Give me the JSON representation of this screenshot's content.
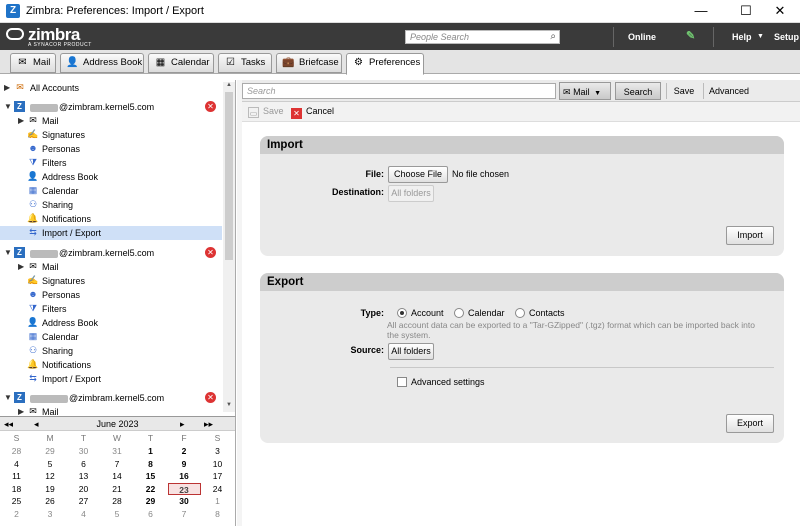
{
  "window": {
    "title": "Zimbra: Preferences: Import / Export",
    "app_icon": "Z",
    "minimize": "—",
    "maximize": "☐",
    "close": "✕"
  },
  "header": {
    "logo_text": "zimbra",
    "logo_sub": "A SYNACOR PRODUCT",
    "people_search_placeholder": "People Search",
    "status": "Online",
    "help": "Help",
    "setup": "Setup"
  },
  "tabs": [
    {
      "label": "Mail",
      "icon": "✉"
    },
    {
      "label": "Address Book",
      "icon": "👤"
    },
    {
      "label": "Calendar",
      "icon": "▦"
    },
    {
      "label": "Tasks",
      "icon": "☑"
    },
    {
      "label": "Briefcase",
      "icon": "💼"
    },
    {
      "label": "Preferences",
      "icon": "⚙"
    }
  ],
  "tree": {
    "all_accounts": "All Accounts",
    "account1": {
      "email_suffix": "@zimbram.kernel5.com",
      "items": [
        "Mail",
        "Signatures",
        "Personas",
        "Filters",
        "Address Book",
        "Calendar",
        "Sharing",
        "Notifications",
        "Import / Export"
      ]
    },
    "account2": {
      "email_suffix": "@zimbram.kernel5.com",
      "items": [
        "Mail",
        "Signatures",
        "Personas",
        "Filters",
        "Address Book",
        "Calendar",
        "Sharing",
        "Notifications",
        "Import / Export"
      ]
    },
    "account3": {
      "email_suffix": "@zimbram.kernel5.com",
      "partial_item": "Mail"
    }
  },
  "calendar": {
    "month": "June 2023",
    "nav": {
      "prev_year": "◂◂",
      "prev_month": "◂",
      "next_month": "▸",
      "next_year": "▸▸"
    },
    "weekdays": [
      "S",
      "M",
      "T",
      "W",
      "T",
      "F",
      "S"
    ],
    "weeks": [
      [
        "28",
        "29",
        "30",
        "31",
        "1",
        "2",
        "3"
      ],
      [
        "4",
        "5",
        "6",
        "7",
        "8",
        "9",
        "10"
      ],
      [
        "11",
        "12",
        "13",
        "14",
        "15",
        "16",
        "17"
      ],
      [
        "18",
        "19",
        "20",
        "21",
        "22",
        "23",
        "24"
      ],
      [
        "25",
        "26",
        "27",
        "28",
        "29",
        "30",
        "1"
      ],
      [
        "2",
        "3",
        "4",
        "5",
        "6",
        "7",
        "8"
      ]
    ],
    "today": "23"
  },
  "searchbar": {
    "placeholder": "Search",
    "scope": "Mail",
    "search_btn": "Search",
    "save_btn": "Save",
    "advanced_btn": "Advanced"
  },
  "prefbar": {
    "save": "Save",
    "cancel": "Cancel"
  },
  "import": {
    "title": "Import",
    "file_label": "File:",
    "choose_file": "Choose File",
    "no_file": "No file chosen",
    "destination_label": "Destination:",
    "destination_value": "All folders",
    "import_btn": "Import"
  },
  "export": {
    "title": "Export",
    "type_label": "Type:",
    "types": [
      "Account",
      "Calendar",
      "Contacts"
    ],
    "selected_type": "Account",
    "note": "All account data can be exported to a \"Tar-GZipped\" (.tgz) format which can be imported back into the system.",
    "source_label": "Source:",
    "source_value": "All folders",
    "advanced_settings": "Advanced settings",
    "export_btn": "Export"
  },
  "colors": {
    "header_bg": "#3a3a3a",
    "selected_row": "#cfe0f7",
    "account_icon": "#2b6fbf",
    "remove_icon": "#dd3333"
  }
}
